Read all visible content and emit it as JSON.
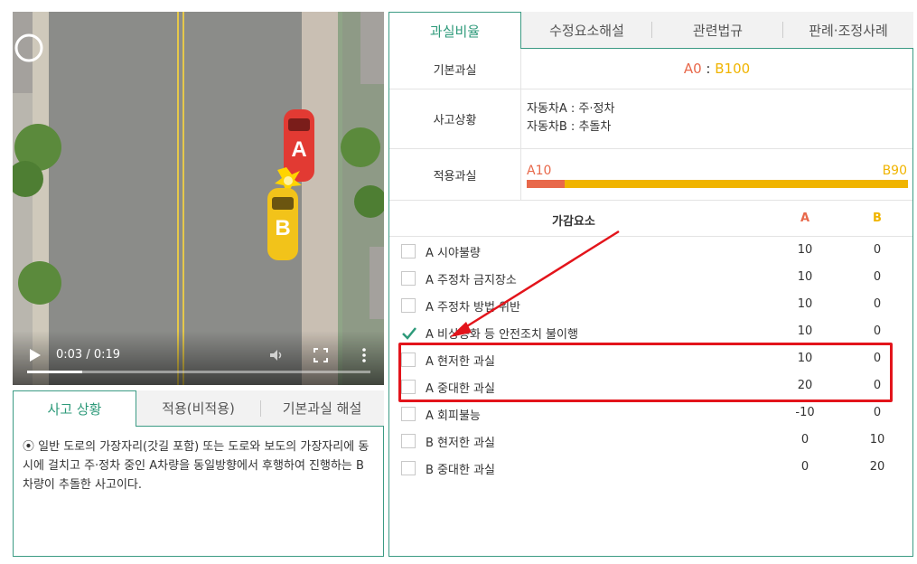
{
  "video": {
    "car_a_label": "A",
    "car_b_label": "B",
    "time": "0:03 / 0:19",
    "progress": 0.16,
    "icons": [
      "play-icon",
      "volume-icon",
      "fullscreen-icon",
      "more-icon"
    ]
  },
  "left_tabs": [
    "사고 상황",
    "적용(비적용)",
    "기본과실 해설"
  ],
  "left_panel": {
    "bullet": "⦿",
    "text": "일반 도로의 가장자리(갓길 포함) 또는 도로와 보도의 가장자리에 동시에 걸치고 주·정차 중인 A차량을 동일방향에서 후행하여 진행하는 B차량이 추돌한 사고이다."
  },
  "right_tabs": [
    "과실비율",
    "수정요소해설",
    "관련법규",
    "판례·조정사례"
  ],
  "basic": {
    "label": "기본과실",
    "a": "A0",
    "sep": " : ",
    "b": "B100"
  },
  "situation": {
    "label": "사고상황",
    "line1": "자동차A : 주·정차",
    "line2": "자동차B : 추돌차"
  },
  "applied": {
    "label": "적용과실",
    "a_text": "A10",
    "b_text": "B90",
    "a_value": 10,
    "b_value": 90
  },
  "factors": {
    "header": "가감요소",
    "col_a": "A",
    "col_b": "B",
    "rows": [
      {
        "label": "A 시야불량",
        "a": "10",
        "b": "0",
        "checked": false
      },
      {
        "label": "A 주정차 금지장소",
        "a": "10",
        "b": "0",
        "checked": false
      },
      {
        "label": "A 주정차 방법 위반",
        "a": "10",
        "b": "0",
        "checked": false
      },
      {
        "label": "A 비상등화 등 안전조치 불이행",
        "a": "10",
        "b": "0",
        "checked": true
      },
      {
        "label": "A 현저한 과실",
        "a": "10",
        "b": "0",
        "checked": false
      },
      {
        "label": "A 중대한 과실",
        "a": "20",
        "b": "0",
        "checked": false
      },
      {
        "label": "A 회피불능",
        "a": "-10",
        "b": "0",
        "checked": false
      },
      {
        "label": "B 현저한 과실",
        "a": "0",
        "b": "10",
        "checked": false
      },
      {
        "label": "B 중대한 과실",
        "a": "0",
        "b": "20",
        "checked": false
      }
    ]
  },
  "colors": {
    "accent": "#2e9a7a",
    "a_color": "#e8684a",
    "b_color": "#f0b400",
    "highlight": "#e3141b"
  }
}
